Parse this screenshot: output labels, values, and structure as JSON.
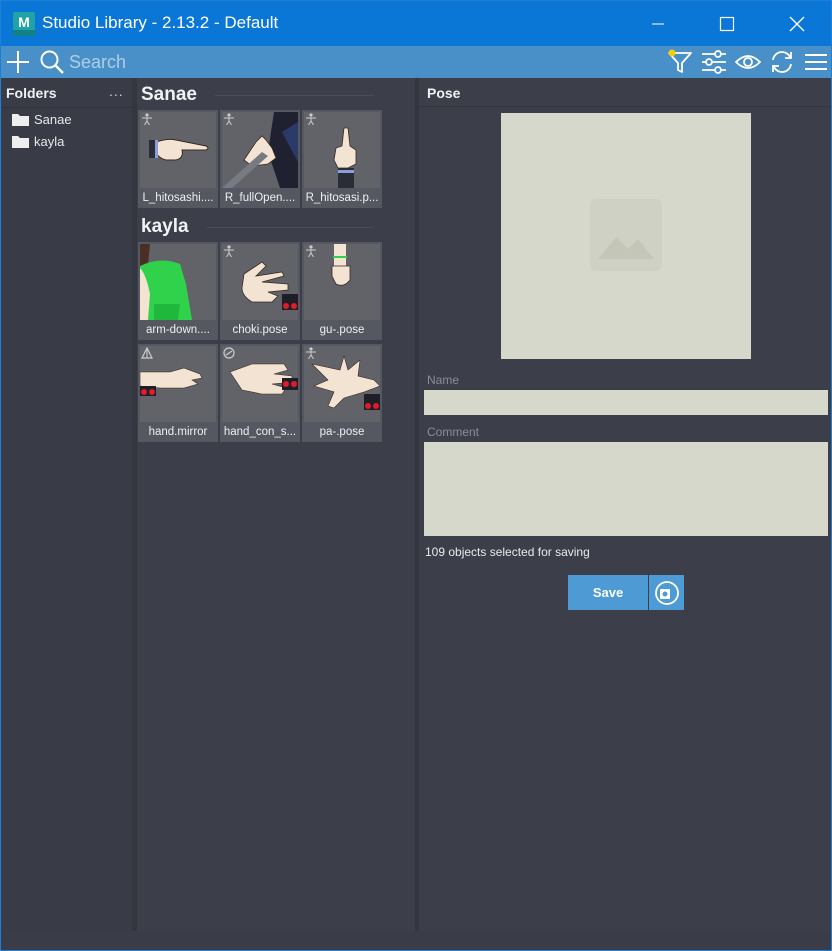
{
  "window": {
    "title": "Studio Library - 2.13.2 - Default",
    "app_icon_letter": "M"
  },
  "toolbar": {
    "search_placeholder": "Search",
    "icons": [
      "add-icon",
      "search-icon",
      "filter-icon",
      "settings-sliders-icon",
      "eye-icon",
      "refresh-icon",
      "menu-icon"
    ]
  },
  "folders": {
    "header": "Folders",
    "more": "...",
    "items": [
      {
        "label": "Sanae"
      },
      {
        "label": "kayla"
      }
    ]
  },
  "library": {
    "groups": [
      {
        "title": "Sanae",
        "items": [
          {
            "label": "L_hitosashi....",
            "badge": "pose-icon"
          },
          {
            "label": "R_fullOpen....",
            "badge": "pose-icon"
          },
          {
            "label": "R_hitosasi.p...",
            "badge": "pose-icon"
          }
        ]
      },
      {
        "title": "kayla",
        "items": [
          {
            "label": "arm-down....",
            "badge": ""
          },
          {
            "label": "choki.pose",
            "badge": "pose-icon"
          },
          {
            "label": "gu-.pose",
            "badge": "pose-icon"
          },
          {
            "label": "hand.mirror",
            "badge": "mirror-icon"
          },
          {
            "label": "hand_con_s...",
            "badge": "selection-set-icon"
          },
          {
            "label": "pa-.pose",
            "badge": "pose-icon"
          }
        ]
      }
    ]
  },
  "pose": {
    "header": "Pose",
    "name_label": "Name",
    "name_value": "",
    "comment_label": "Comment",
    "comment_value": "",
    "status": "109 objects selected for saving",
    "save_label": "Save"
  },
  "colors": {
    "titlebar": "#0a77d6",
    "toolbar": "#4a90c8",
    "background": "#3c3f4a",
    "accent_button": "#4e9ad4",
    "field": "#d6d8cb"
  }
}
